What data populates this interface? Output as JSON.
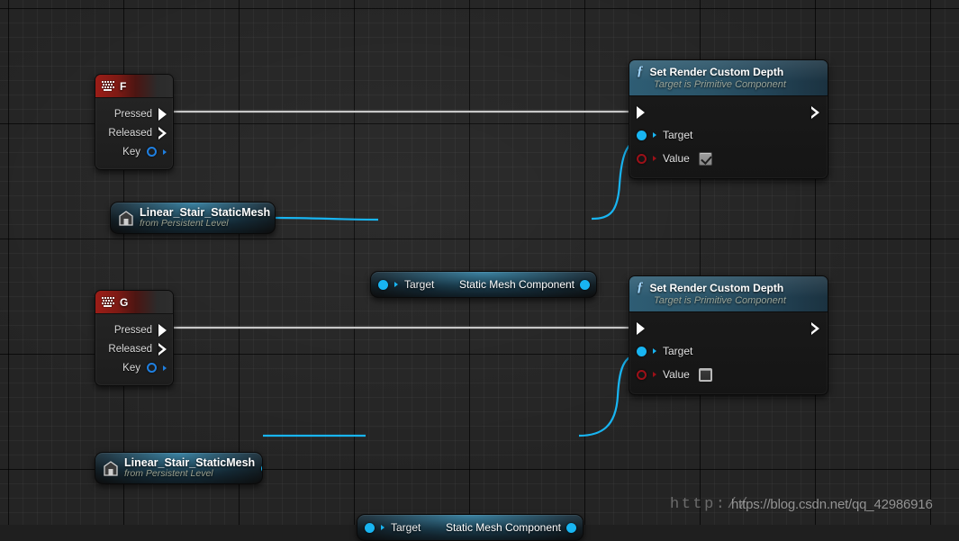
{
  "app": {
    "context": "Unreal Engine Blueprint Event Graph"
  },
  "graph": {
    "nodes": [
      {
        "id": "event-f",
        "type": "input-action-event",
        "title": "F",
        "icon": "keyboard-icon",
        "pins": [
          {
            "label": "Pressed",
            "kind": "exec-out",
            "connected": true
          },
          {
            "label": "Released",
            "kind": "exec-out",
            "connected": false
          },
          {
            "label": "Key",
            "kind": "data-out",
            "datatype": "struct",
            "connected": false
          }
        ]
      },
      {
        "id": "event-g",
        "type": "input-action-event",
        "title": "G",
        "icon": "keyboard-icon",
        "pins": [
          {
            "label": "Pressed",
            "kind": "exec-out",
            "connected": true
          },
          {
            "label": "Released",
            "kind": "exec-out",
            "connected": false
          },
          {
            "label": "Key",
            "kind": "data-out",
            "datatype": "struct",
            "connected": false
          }
        ]
      },
      {
        "id": "fn-srcd-1",
        "type": "function-call",
        "title": "Set Render Custom Depth",
        "subtitle": "Target is Primitive Component",
        "icon": "function-icon",
        "inputs": [
          {
            "label": "Target",
            "datatype": "object",
            "connected": true
          },
          {
            "label": "Value",
            "datatype": "boolean",
            "connected": false,
            "checkbox": true
          }
        ]
      },
      {
        "id": "fn-srcd-2",
        "type": "function-call",
        "title": "Set Render Custom Depth",
        "subtitle": "Target is Primitive Component",
        "icon": "function-icon",
        "inputs": [
          {
            "label": "Target",
            "datatype": "object",
            "connected": true
          },
          {
            "label": "Value",
            "datatype": "boolean",
            "connected": false,
            "checkbox": false
          }
        ]
      },
      {
        "id": "actor-ref-1",
        "type": "actor-reference",
        "name": "Linear_Stair_StaticMesh",
        "subtitle": "from Persistent Level",
        "icon": "actor-icon"
      },
      {
        "id": "actor-ref-2",
        "type": "actor-reference",
        "name": "Linear_Stair_StaticMesh",
        "subtitle": "from Persistent Level",
        "icon": "actor-icon"
      },
      {
        "id": "getter-1",
        "type": "component-getter",
        "input_label": "Target",
        "output_label": "Static Mesh Component"
      },
      {
        "id": "getter-2",
        "type": "component-getter",
        "input_label": "Target",
        "output_label": "Static Mesh Component"
      }
    ],
    "colors": {
      "exec_wire": "#c8c8c8",
      "object_wire": "#18b5f2",
      "event_header": "#9c1d17",
      "function_header": "#2e5d74",
      "canvas": "#242424"
    }
  },
  "watermarks": {
    "http_text": "http://",
    "csdn_text": "https://blog.csdn.net/qq_42986916"
  }
}
